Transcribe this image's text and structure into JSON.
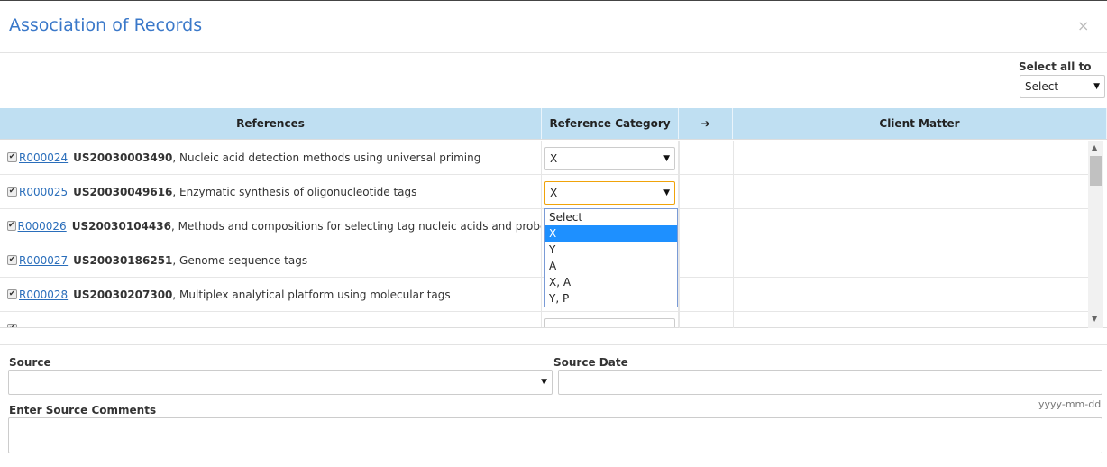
{
  "modal": {
    "title": "Association of Records",
    "close": "×"
  },
  "select_all": {
    "label": "Select all to",
    "value": "Select"
  },
  "table": {
    "headers": [
      "References",
      "Reference Category",
      "➔",
      "Client Matter"
    ],
    "rows": [
      {
        "id": "R000024",
        "patent": "US20030003490",
        "title": ", Nucleic acid detection methods using universal priming",
        "category": "X"
      },
      {
        "id": "R000025",
        "patent": "US20030049616",
        "title": ", Enzymatic synthesis of oligonucleotide tags",
        "category": "X"
      },
      {
        "id": "R000026",
        "patent": "US20030104436",
        "title": ", Methods and compositions for selecting tag nucleic acids and probe arrays",
        "category": ""
      },
      {
        "id": "R000027",
        "patent": "US20030186251",
        "title": ", Genome sequence tags",
        "category": ""
      },
      {
        "id": "R000028",
        "patent": "US20030207300",
        "title": ", Multiplex analytical platform using molecular tags",
        "category": ""
      }
    ]
  },
  "dropdown": {
    "options": [
      "Select",
      "X",
      "Y",
      "A",
      "X, A",
      "Y, P"
    ],
    "highlighted": "X"
  },
  "form": {
    "source_label": "Source",
    "source_value": "",
    "source_date_label": "Source Date",
    "source_date_value": "",
    "date_hint": "yyyy-mm-dd",
    "comments_label": "Enter Source Comments",
    "comments_value": ""
  },
  "icons": {
    "checkbox": "checkbox-checked-icon",
    "arrow": "caret-down-icon"
  },
  "colors": {
    "title": "#3a78c9",
    "header_bg": "#bfdff2",
    "link": "#2a6ebb",
    "highlight": "#1e90ff",
    "focus": "#f0a30a"
  }
}
